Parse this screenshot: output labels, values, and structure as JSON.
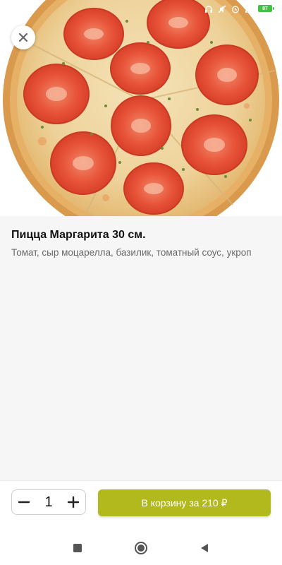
{
  "status_bar": {
    "icons": [
      "headphones-icon",
      "muted-icon",
      "alarm-icon",
      "signal-icon"
    ],
    "battery_level": "87",
    "battery_color": "#44c144"
  },
  "hero": {
    "image": "pizza-margherita-photo",
    "close_icon": "close-icon"
  },
  "product": {
    "title": "Пицца Маргарита 30 см.",
    "description": "Томат, сыр моцарелла, базилик, томатный соус, укроп"
  },
  "order": {
    "decrease_icon": "minus-icon",
    "quantity": "1",
    "increase_icon": "plus-icon",
    "cart_button_label": "В корзину за 210 ₽",
    "accent_color": "#b2b91c"
  },
  "nav_bar": {
    "buttons": [
      "recent-apps-icon",
      "home-icon",
      "back-icon"
    ]
  }
}
